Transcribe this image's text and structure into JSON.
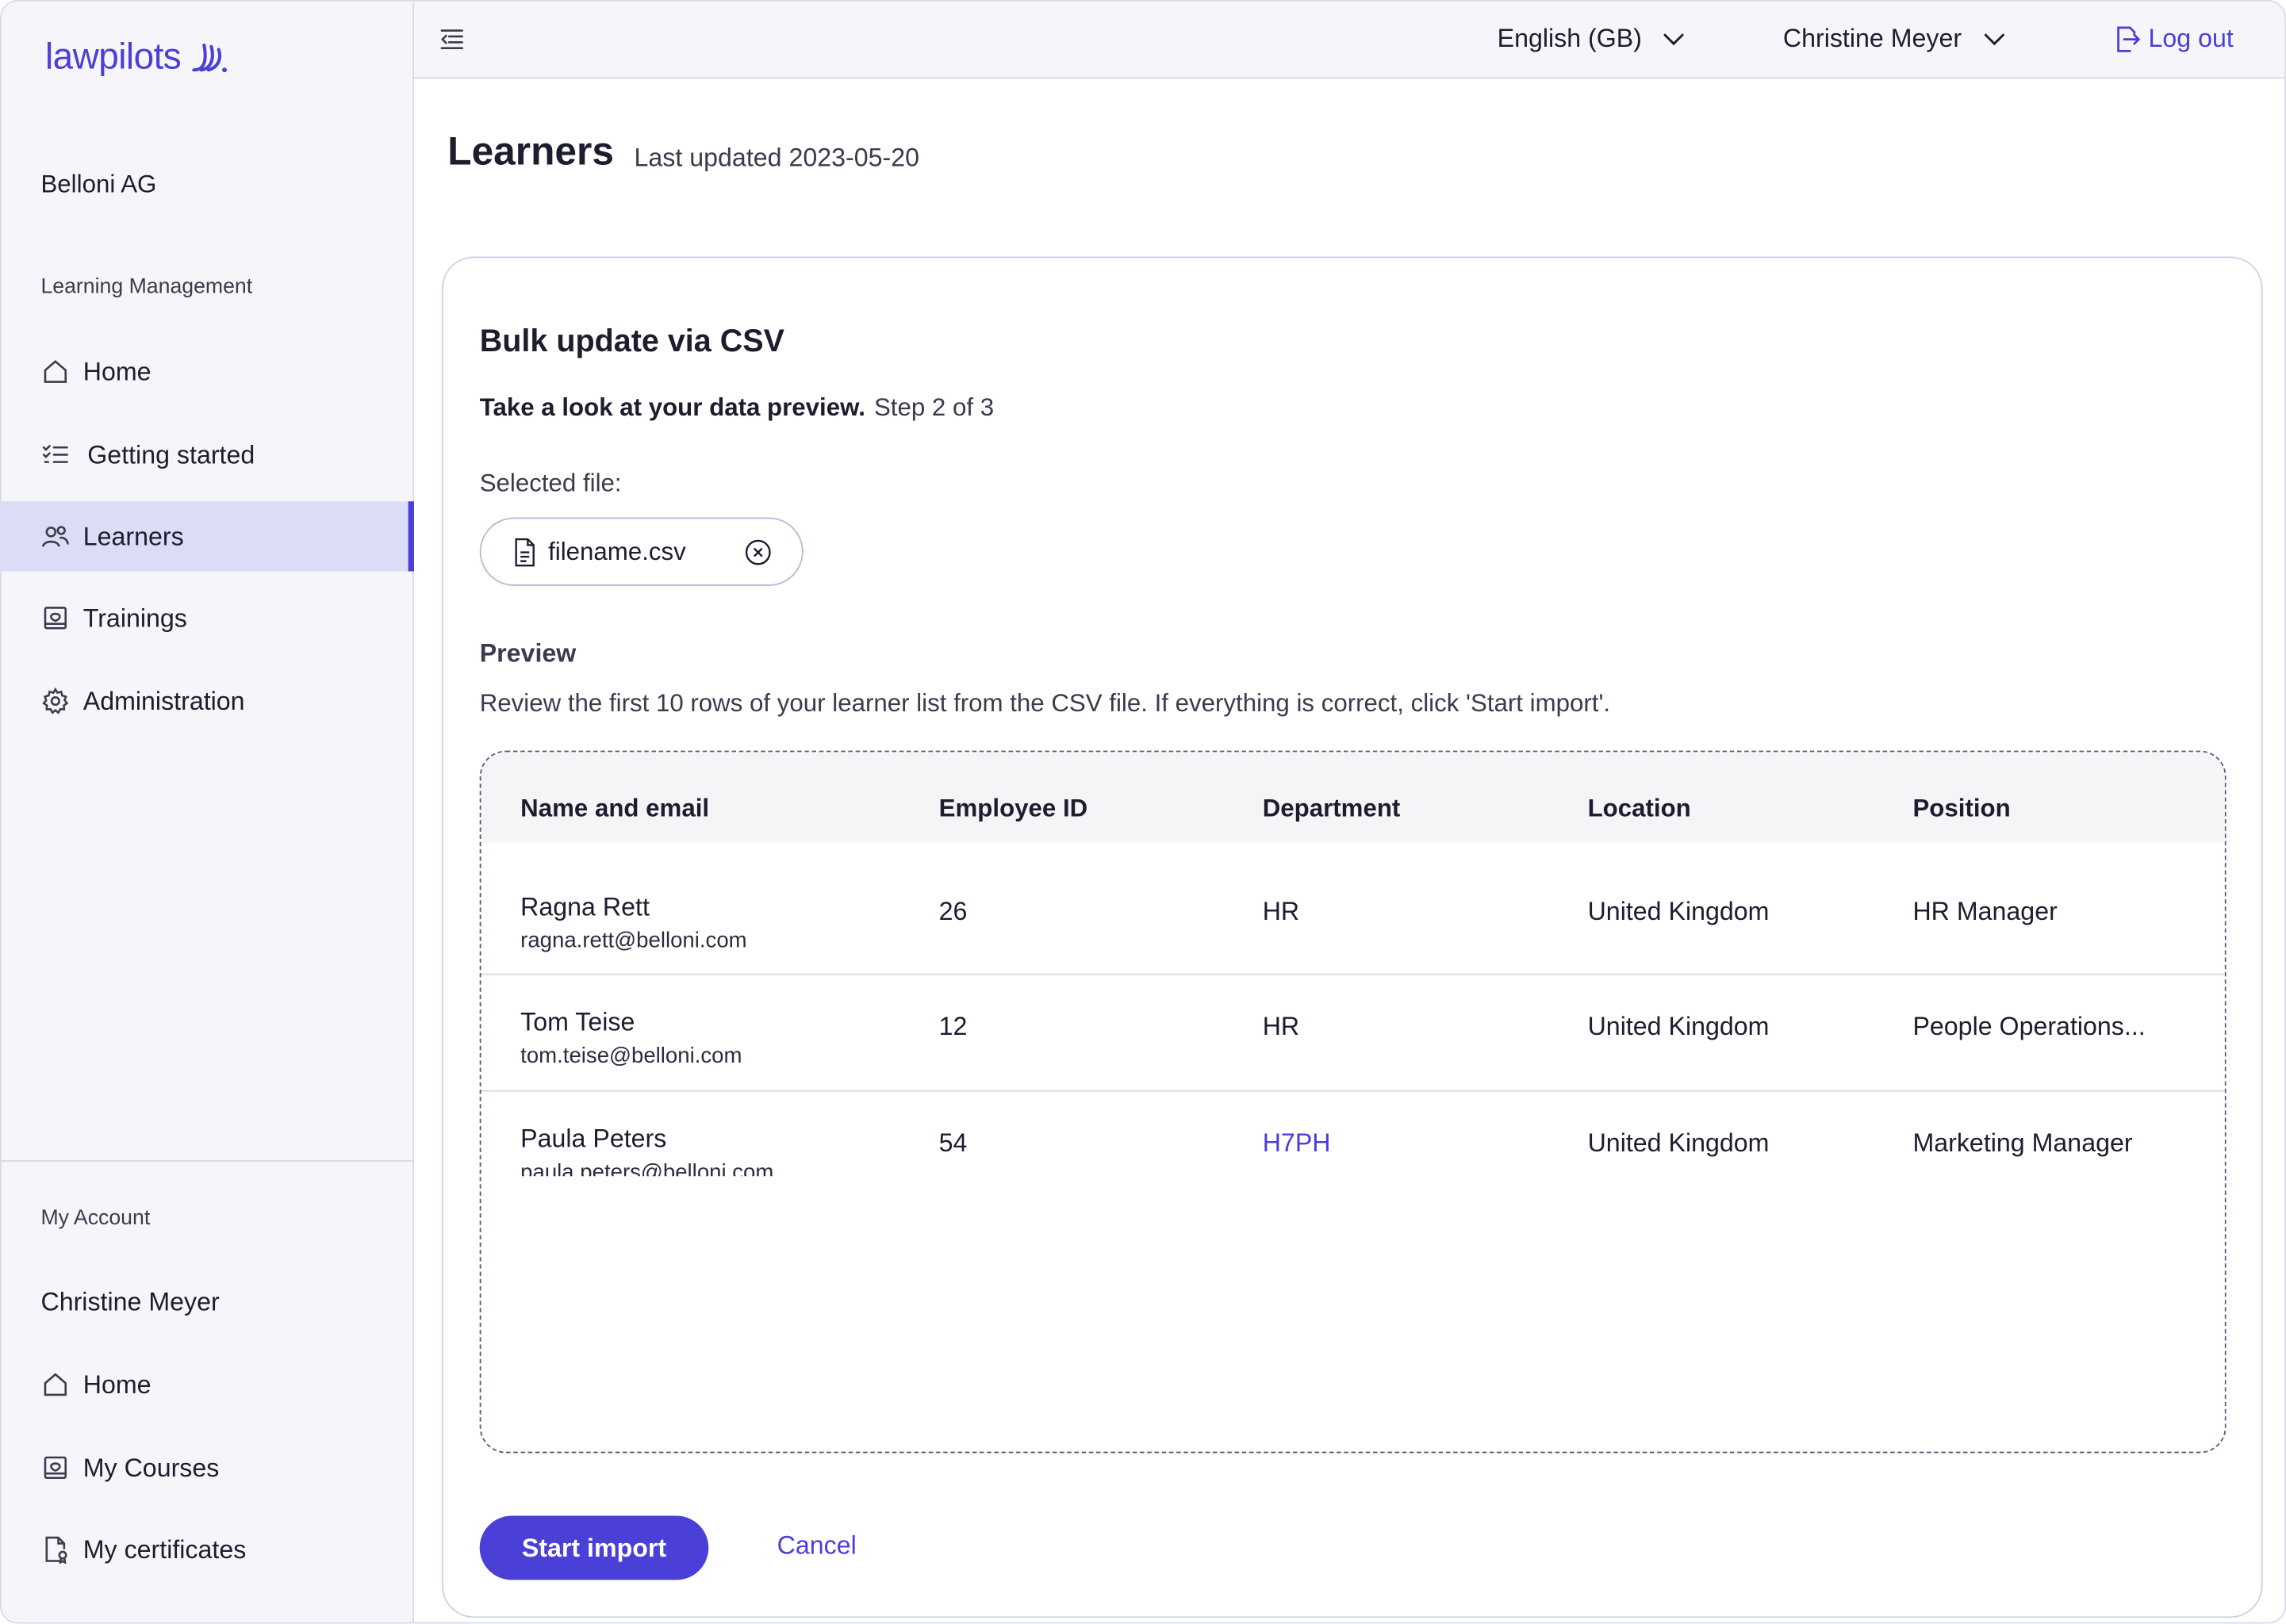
{
  "brand": {
    "name": "lawpilots",
    "accent": "#4a3fd6"
  },
  "sidebar": {
    "org_name": "Belloni AG",
    "section_label": "Learning Management",
    "items": [
      {
        "label": "Home",
        "icon": "home-icon",
        "active": false
      },
      {
        "label": "Getting started",
        "icon": "checklist-icon",
        "active": false
      },
      {
        "label": "Learners",
        "icon": "users-icon",
        "active": true
      },
      {
        "label": "Trainings",
        "icon": "training-icon",
        "active": false
      },
      {
        "label": "Administration",
        "icon": "gear-icon",
        "active": false
      }
    ],
    "account_section_label": "My Account",
    "account_name": "Christine Meyer",
    "account_items": [
      {
        "label": "Home",
        "icon": "home-icon"
      },
      {
        "label": "My Courses",
        "icon": "training-icon"
      },
      {
        "label": "My certificates",
        "icon": "certificate-icon"
      }
    ]
  },
  "topbar": {
    "language": "English (GB)",
    "user": "Christine Meyer",
    "logout_label": "Log out"
  },
  "page": {
    "title": "Learners",
    "last_updated": "Last updated 2023-05-20"
  },
  "card": {
    "title": "Bulk update via CSV",
    "step_prompt": "Take a look at your data preview.",
    "step_counter": "Step 2 of 3",
    "selected_file_label": "Selected file:",
    "file_name": "filename.csv",
    "preview_title": "Preview",
    "preview_description": "Review the first 10 rows of your learner list from the CSV file. If everything is correct, click 'Start import'.",
    "table": {
      "columns": [
        "Name and email",
        "Employee ID",
        "Department",
        "Location",
        "Position"
      ],
      "rows": [
        {
          "name": "Ragna Rett",
          "email": "ragna.rett@belloni.com",
          "employee_id": "26",
          "department": "HR",
          "location": "United Kingdom",
          "position": "HR Manager"
        },
        {
          "name": "Tom Teise",
          "email": "tom.teise@belloni.com",
          "employee_id": "12",
          "department": "HR",
          "location": "United Kingdom",
          "position": "People Operations..."
        },
        {
          "name": "Paula Peters",
          "email": "paula.peters@belloni.com",
          "employee_id": "54",
          "department": "H7PH",
          "location": "United Kingdom",
          "position": "Marketing Manager"
        }
      ]
    },
    "primary_button": "Start import",
    "cancel_button": "Cancel"
  }
}
